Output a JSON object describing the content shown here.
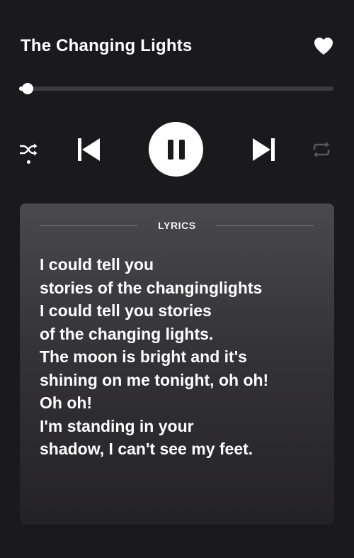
{
  "track": {
    "title": "The Changing Lights",
    "liked": true,
    "progress": 0.02
  },
  "controls": {
    "shuffle_icon": "shuffle-icon",
    "shuffle_active": true,
    "prev_icon": "skip-previous-icon",
    "play_state": "playing",
    "play_icon": "pause-icon",
    "next_icon": "skip-next-icon",
    "repeat_icon": "repeat-icon",
    "repeat_active": false
  },
  "lyrics": {
    "label": "LYRICS",
    "lines": [
      "I could tell you",
      "stories of the changinglights",
      "I could tell you stories",
      "of the changing lights.",
      "The moon is bright and it's",
      "shining on me tonight, oh oh!",
      "Oh oh!",
      "I'm standing in your",
      "shadow, I can't see my feet."
    ]
  },
  "colors": {
    "background": "#1a191b",
    "accent": "#ffffff",
    "track": "#3b3a3e",
    "inactive_icon": "#5a595d"
  }
}
